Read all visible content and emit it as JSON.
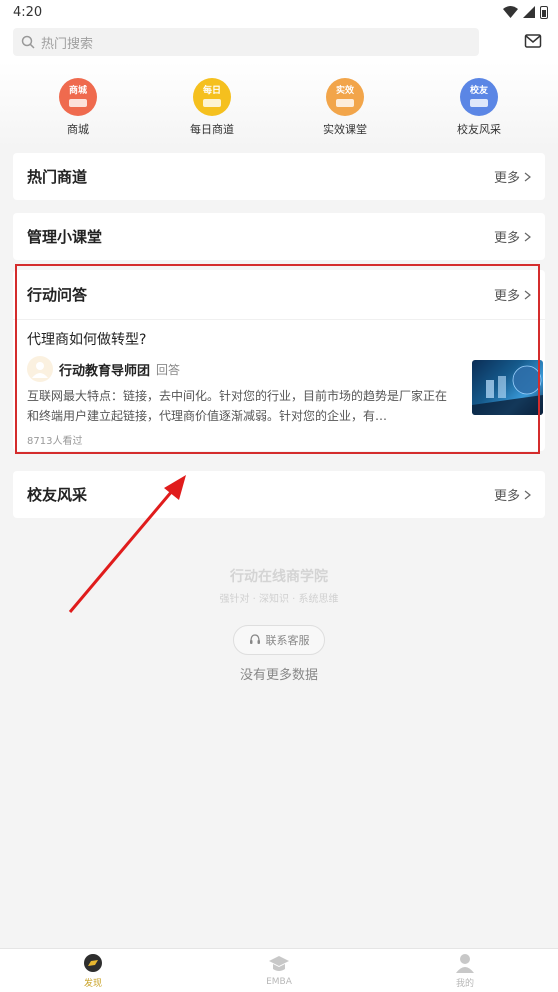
{
  "status_bar": {
    "time": "4:20"
  },
  "search": {
    "placeholder": "热门搜索",
    "mail_icon": "mail-icon"
  },
  "quick_nav": [
    {
      "badge": "商城",
      "label": "商城",
      "color": "#ef6a4e"
    },
    {
      "badge": "每日",
      "label": "每日商道",
      "color": "#f5c01e"
    },
    {
      "badge": "实效",
      "label": "实效课堂",
      "color": "#f2a54a"
    },
    {
      "badge": "校友",
      "label": "校友风采",
      "color": "#5b86e5"
    }
  ],
  "sections": {
    "hot_business": {
      "title": "热门商道",
      "more": "更多"
    },
    "management_class": {
      "title": "管理小课堂",
      "more": "更多"
    },
    "action_qa": {
      "title": "行动问答",
      "more": "更多",
      "question": "代理商如何做转型?",
      "author": "行动教育导师团",
      "answer_tag": "回答",
      "answer": "互联网最大特点：链接，去中间化。针对您的行业，目前市场的趋势是厂家正在和终端用户建立起链接，代理商价值逐渐减弱。针对您的企业，有…",
      "views": "8713人看过"
    },
    "alumni": {
      "title": "校友风采",
      "more": "更多"
    }
  },
  "footer": {
    "brand_name": "行动在线商学院",
    "slogan": "强针对 · 深知识 · 系统思维",
    "contact": "联系客服",
    "no_more": "没有更多数据"
  },
  "tabbar": [
    {
      "label": "发现",
      "active": true
    },
    {
      "label": "EMBA",
      "active": false
    },
    {
      "label": "我的",
      "active": false
    }
  ],
  "colors": {
    "highlight": "#d42c2c",
    "active_tab": "#c9a227"
  }
}
